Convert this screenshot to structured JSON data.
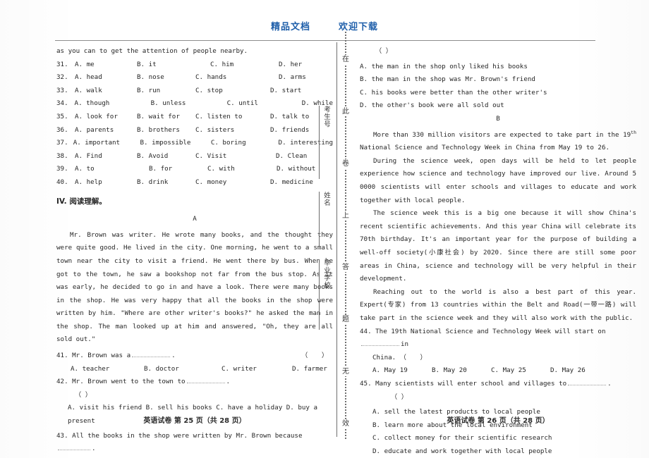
{
  "banner": {
    "left_text": "精品文档",
    "right_text": "欢迎下载",
    "color": "#1f5faa"
  },
  "seal": {
    "vertical_notice": [
      "在",
      "此",
      "卷",
      "上",
      "答",
      "题",
      "无",
      "效"
    ],
    "fields": [
      {
        "label": "考生号"
      },
      {
        "label": "姓名"
      },
      {
        "label": "毕业学校"
      }
    ]
  },
  "left_column": {
    "cloze_continuation": "as you can to get the attention of people nearby.",
    "cloze_questions": [
      {
        "num": "31.",
        "a": "A. me",
        "b": "B. it",
        "c": "C. him",
        "d": "D. her"
      },
      {
        "num": "32.",
        "a": "A. head",
        "b": "B. nose",
        "c": "C. hands",
        "d": "D. arms"
      },
      {
        "num": "33.",
        "a": "A. walk",
        "b": "B. run",
        "c": "C. stop",
        "d": "D. start"
      },
      {
        "num": "34.",
        "a": "A. though",
        "b": "B. unless",
        "c": "C. until",
        "d": "D. while"
      },
      {
        "num": "35.",
        "a": "A. look for",
        "b": "B. wait for",
        "c": "C. listen to",
        "d": "D. talk to"
      },
      {
        "num": "36.",
        "a": "A. parents",
        "b": "B. brothers",
        "c": "C. sisters",
        "d": "D. friends"
      },
      {
        "num": "37.",
        "a": "A. important",
        "b": "B. impossible",
        "c": "C. boring",
        "d": "D. interesting"
      },
      {
        "num": "38.",
        "a": "A. Find",
        "b": "B. Avoid",
        "c": "C. Visit",
        "d": "D. Clean"
      },
      {
        "num": "39.",
        "a": "A. to",
        "b": "B. for",
        "c": "C. with",
        "d": "D. without"
      },
      {
        "num": "40.",
        "a": "A. help",
        "b": "B. drink",
        "c": "C. money",
        "d": "D. medicine"
      }
    ],
    "section_heading": "IV. 阅读理解。",
    "passage_a_label": "A",
    "passage_a_text": "Mr. Brown was writer. He wrote many books, and the thought they were quite good. He lived in the city. One morning, he went to a small town near the city to visit a friend. He went there by bus. When he got to the town, he saw a bookshop not far from the bus stop. As it was early, he decided to go in and have a look. There were many books in the shop. He was very happy that all the books in the shop were written by him. \"Where are other writer's books?\" he asked the man in the shop. The man looked up at him and answered, \"Oh, they are all sold out.\"",
    "q41": {
      "stem": "41. Mr. Brown was a",
      "stem_tail": ".",
      "bracket": "（   ）",
      "a": "A. teacher",
      "b": "B. doctor",
      "c": "C. writer",
      "d": "D. farmer"
    },
    "q42": {
      "stem": "42. Mr. Brown went to the town to",
      "stem_tail": ".",
      "bracket": "（   ）",
      "options_line1": "A. visit his friend  B. sell his books   C. have a holiday   D.    buy    a",
      "options_line2": "present"
    },
    "q43": {
      "stem": "43. All the books in the shop were written by Mr. Brown because",
      "stem_tail": "."
    },
    "footer": "英语试卷  第 25 页（共 28 页）"
  },
  "right_column": {
    "q43_bracket": "（   ）",
    "q43_options": [
      "A. the man in the shop only liked his books",
      "B. the man in the shop was Mr. Brown's friend",
      "C. his books were better than the other writer's",
      "D. the other's book were all sold out"
    ],
    "passage_b_label": "B",
    "passage_b_p1_pre": "More than 330 million visitors are expected to take part in the 19",
    "passage_b_p1_sup": "th",
    "passage_b_p1_post": " National Science and Technology Week in China from May 19 to 26.",
    "passage_b_p2": "During the science week, open days will be held to let people experience how science and technology have improved our live. Around 5 0000 scientists will enter schools and villages to educate and work together with local people.",
    "passage_b_p3": "The science week this is a big one because it will show China's recent scientific achievements. And this year China will celebrate its 70th birthday. It's an important year for the purpose of building a well-off society(小康社会) by 2020. Since there are still some poor areas in China, science and technology will be very helpful in their development.",
    "passage_b_p4": "Reaching out to the world is also a best part of this year. Expert(专家) from 13 countries within the Belt and Road(一带一路) will take part in the science week and they will also work with the public.",
    "q44": {
      "stem_pre": "44. The 19th National Science and Technology Week will start on",
      "stem_post": "in",
      "stem_line2": "China.",
      "bracket": "（   ）",
      "a": "A. May 19",
      "b": "B. May 20",
      "c": "C. May 25",
      "d": "D. May 26"
    },
    "q45": {
      "stem": "45. Many scientists will enter school and villages to",
      "stem_tail": ".",
      "bracket": "（   ）",
      "options": [
        "A. sell the latest products to local people",
        "B. learn more about the local environment",
        "C. collect money for their scientific research",
        "D. educate and work together with local people"
      ]
    },
    "footer": "英语试卷  第 26 页（共 28 页）"
  }
}
